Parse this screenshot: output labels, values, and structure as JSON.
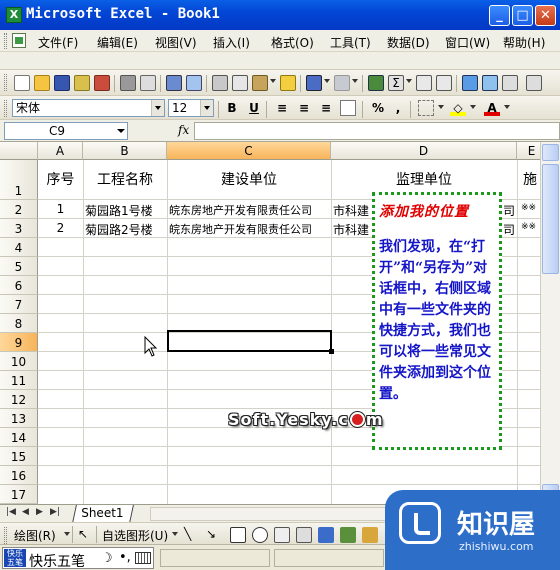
{
  "window": {
    "title": "Microsoft Excel - Book1",
    "app_icon": "X",
    "controls": [
      "minimize",
      "maximize",
      "close"
    ]
  },
  "menubar": {
    "items": [
      "文件(F)",
      "编辑(E)",
      "视图(V)",
      "插入(I)",
      "格式(O)",
      "工具(T)",
      "数据(D)",
      "窗口(W)",
      "帮助(H)"
    ]
  },
  "formatting": {
    "font_name": "宋体",
    "font_size": "12",
    "bold": "B",
    "underline": "U",
    "percent": "%",
    "comma": ","
  },
  "formula_bar": {
    "name_box": "C9",
    "fx_label": "fx",
    "formula": ""
  },
  "sheet": {
    "columns": [
      "A",
      "B",
      "C",
      "D",
      "E"
    ],
    "active_column": "C",
    "rows": [
      "1",
      "2",
      "3",
      "4",
      "5",
      "6",
      "7",
      "8",
      "9",
      "10",
      "11",
      "12",
      "13",
      "14",
      "15",
      "16",
      "17"
    ],
    "active_row": "9",
    "active_cell": "C9",
    "headers": [
      "序号",
      "工程名称",
      "建设单位",
      "监理单位",
      "施"
    ],
    "data": [
      [
        "1",
        "菊园路1号楼",
        "皖东房地产开发有限责任公司",
        "市科建",
        "司",
        "※※"
      ],
      [
        "2",
        "菊园路2号楼",
        "皖东房地产开发有限责任公司",
        "市科建",
        "司",
        "※※"
      ]
    ]
  },
  "sheet_tabs": {
    "tabs": [
      "Sheet1"
    ],
    "nav_buttons": [
      "|◀",
      "◀",
      "▶",
      "▶|"
    ]
  },
  "drawing_toolbar": {
    "draw_label": "绘图(R)",
    "autoshape_label": "自选图形(U)"
  },
  "ime": {
    "logo_text": "快乐\n五笔",
    "name": "快乐五笔",
    "moon": "☽",
    "dot": "•,"
  },
  "annotation": {
    "heading": "添加我的位置",
    "body": "我们发现，在“打开”和“另存为”对话框中，右侧区域中有一些文件夹的快捷方式，我们也可以将一些常见文件夹添加到这个位置。"
  },
  "watermark": {
    "before": "Soft.Yesky.c",
    "after": "m"
  },
  "brand": {
    "name": "知识屋",
    "url": "zhishiwu.com"
  }
}
